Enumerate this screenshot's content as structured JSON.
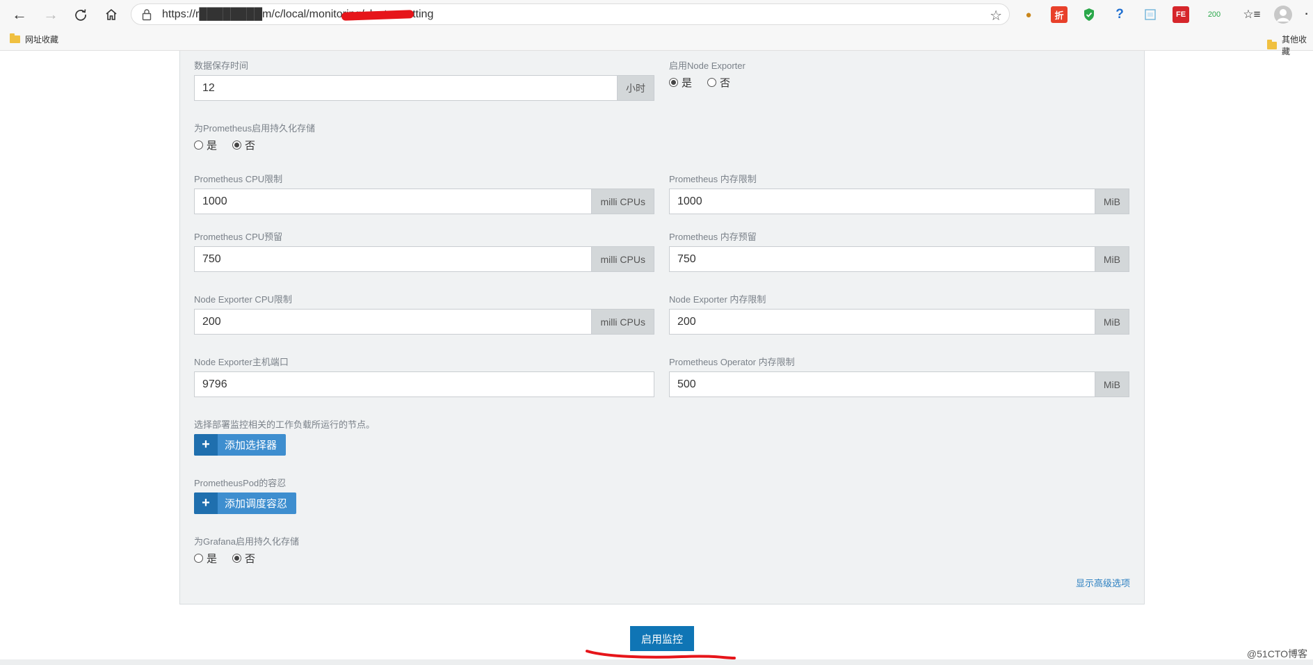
{
  "browser": {
    "url": "https://r████████m/c/local/monitoring/cluster-setting",
    "extension_badge": "200",
    "bookmarks": {
      "left": "网址收藏",
      "right": "其他收藏"
    }
  },
  "form": {
    "retention": {
      "label": "数据保存时间",
      "value": "12",
      "unit": "小时"
    },
    "node_exporter_enable": {
      "label": "启用Node Exporter",
      "yes": "是",
      "no": "否",
      "selected": "yes"
    },
    "prometheus_persist": {
      "label": "为Prometheus启用持久化存储",
      "yes": "是",
      "no": "否",
      "selected": "no"
    },
    "prom_cpu_limit": {
      "label": "Prometheus CPU限制",
      "value": "1000",
      "unit": "milli CPUs"
    },
    "prom_mem_limit": {
      "label": "Prometheus 内存限制",
      "value": "1000",
      "unit": "MiB"
    },
    "prom_cpu_reserve": {
      "label": "Prometheus CPU预留",
      "value": "750",
      "unit": "milli CPUs"
    },
    "prom_mem_reserve": {
      "label": "Prometheus 内存预留",
      "value": "750",
      "unit": "MiB"
    },
    "ne_cpu_limit": {
      "label": "Node Exporter CPU限制",
      "value": "200",
      "unit": "milli CPUs"
    },
    "ne_mem_limit": {
      "label": "Node Exporter 内存限制",
      "value": "200",
      "unit": "MiB"
    },
    "ne_host_port": {
      "label": "Node Exporter主机端口",
      "value": "9796"
    },
    "operator_mem_limit": {
      "label": "Prometheus Operator 内存限制",
      "value": "500",
      "unit": "MiB"
    },
    "node_selector": {
      "label": "选择部署监控相关的工作负载所运行的节点。",
      "button": "添加选择器"
    },
    "toleration": {
      "label": "PrometheusPod的容忍",
      "button": "添加调度容忍"
    },
    "grafana_persist": {
      "label": "为Grafana启用持久化存储",
      "yes": "是",
      "no": "否",
      "selected": "no"
    },
    "advanced_link": "显示高级选项"
  },
  "submit_label": "启用监控",
  "watermark": "@51CTO博客"
}
